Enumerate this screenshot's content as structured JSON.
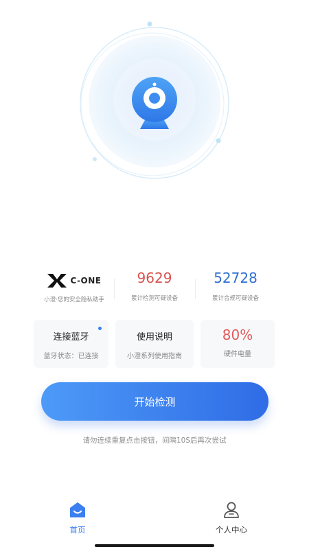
{
  "brand": {
    "logo_text": "C-ONE",
    "caption": "小澄·您的安全隐私助手"
  },
  "stats": [
    {
      "value": "9629",
      "caption": "累计检测可疑设备",
      "color": "#d9534f"
    },
    {
      "value": "52728",
      "caption": "累计合规可疑设备",
      "color": "#2f6fd0"
    }
  ],
  "cards": {
    "bluetooth": {
      "title": "连接蓝牙",
      "status": "蓝牙状态：已连接"
    },
    "manual": {
      "title": "使用说明",
      "subtitle": "小澄系列使用指南"
    },
    "battery": {
      "value": "80%",
      "label": "硬件电量"
    }
  },
  "start_button": {
    "label": "开始检测"
  },
  "hint": "请勿连续重复点击按钮，间隔10S后再次尝试",
  "tabbar": {
    "home": {
      "label": "首页",
      "icon": "home-icon",
      "color": "#3b7ff0"
    },
    "profile": {
      "label": "个人中心",
      "icon": "person-icon",
      "color": "#333333"
    }
  }
}
